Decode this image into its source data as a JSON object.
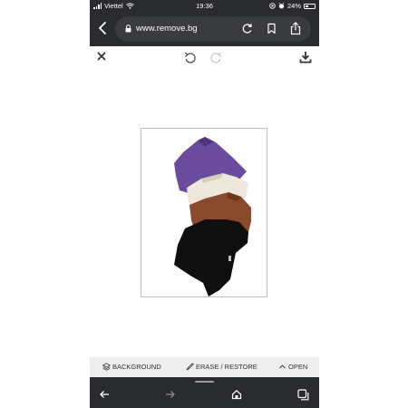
{
  "status_bar": {
    "carrier": "Viettel",
    "time": "19:36",
    "battery": "24%"
  },
  "browser": {
    "url": "www.remove.bg"
  },
  "tools": {
    "background_label": "BACKGROUND",
    "erase_restore_label": "ERASE / RESTORE",
    "open_label": "OPEN"
  },
  "colors": {
    "chrome": "#2a2b2e",
    "pill": "#3a3b3f",
    "toolbar": "#eeeeee"
  },
  "image_content": [
    "purple t-shirt",
    "cream t-shirt",
    "brown t-shirt",
    "black t-shirt"
  ]
}
